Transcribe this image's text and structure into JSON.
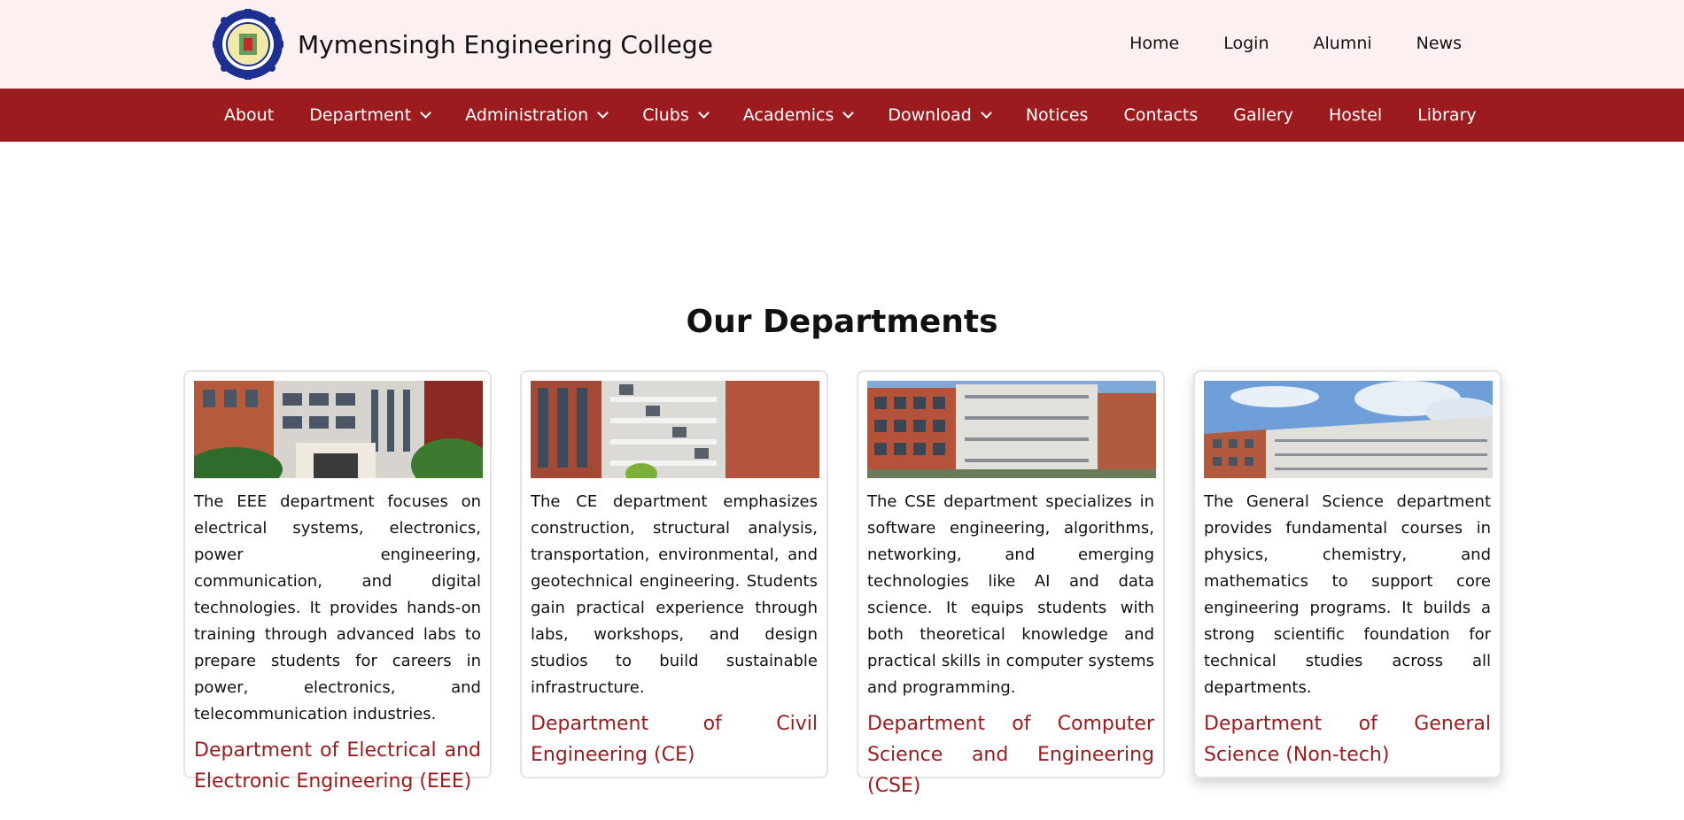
{
  "header": {
    "college_name": "Mymensingh Engineering College",
    "top_links": [
      "Home",
      "Login",
      "Alumni",
      "News"
    ]
  },
  "nav": {
    "items": [
      {
        "label": "About"
      },
      {
        "label": "Department"
      },
      {
        "label": "Administration"
      },
      {
        "label": "Clubs"
      },
      {
        "label": "Academics"
      },
      {
        "label": "Download"
      },
      {
        "label": "Notices"
      },
      {
        "label": "Contacts"
      },
      {
        "label": "Gallery"
      },
      {
        "label": "Hostel"
      },
      {
        "label": "Library"
      }
    ]
  },
  "departments": {
    "heading": "Our Departments",
    "cards": [
      {
        "description": "The EEE department focuses on electrical systems, electronics, power engineering, communication, and digital technologies. It provides hands-on training through advanced labs to prepare students for careers in power, electronics, and telecommunication industries.",
        "title": "Department of Electrical and Electronic Engineering (EEE)"
      },
      {
        "description": "The CE department emphasizes construction, structural analysis, transportation, environmental, and geotechnical engineering. Students gain practical experience through labs, workshops, and design studios to build sustainable infrastructure.",
        "title": "Department of Civil Engineering (CE)"
      },
      {
        "description": "The CSE department specializes in software engineering, algorithms, networking, and emerging technologies like AI and data science. It equips students with both theoretical knowledge and practical skills in computer systems and programming.",
        "title": "Department of Computer Science and Engineering (CSE)"
      },
      {
        "description": "The General Science department provides fundamental courses in physics, chemistry, and mathematics to support core engineering programs. It builds a strong scientific foundation for technical studies across all departments.",
        "title": "Department of General Science (Non-tech)"
      }
    ]
  },
  "colors": {
    "brand_red": "#9b1b1e",
    "header_bg": "#fdf0f0"
  }
}
